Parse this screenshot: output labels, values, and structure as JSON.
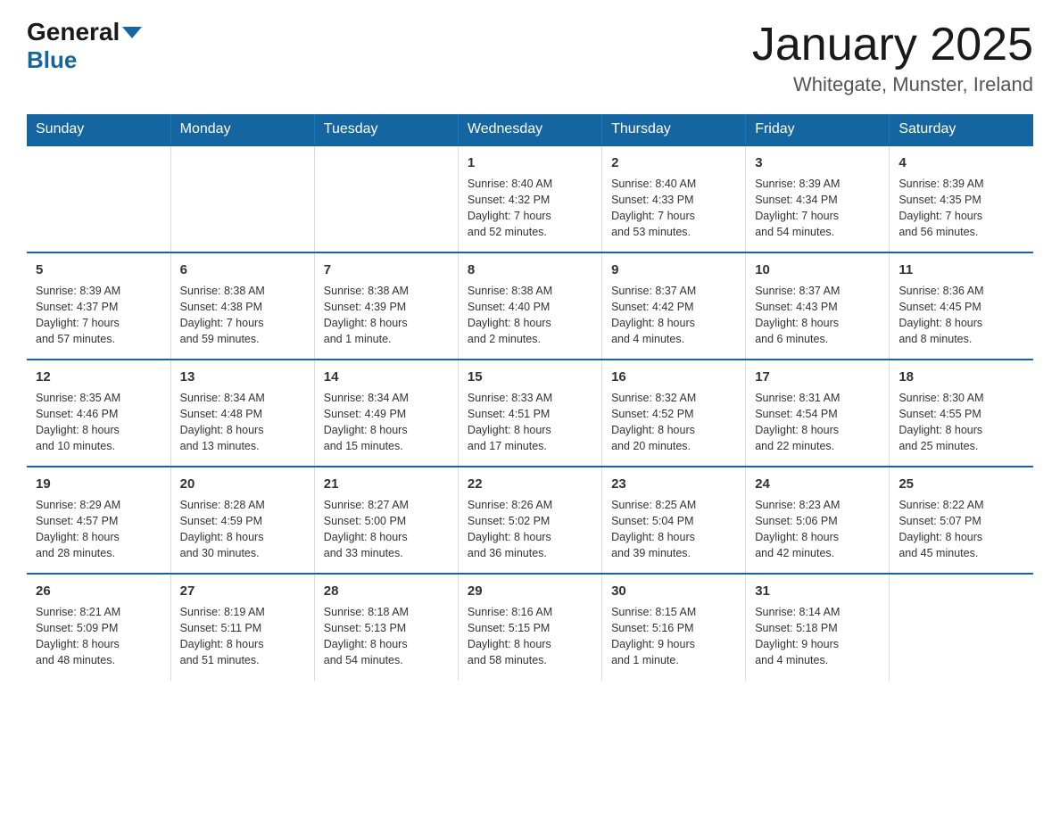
{
  "header": {
    "logo_general": "General",
    "logo_blue": "Blue",
    "month_title": "January 2025",
    "location": "Whitegate, Munster, Ireland"
  },
  "days_of_week": [
    "Sunday",
    "Monday",
    "Tuesday",
    "Wednesday",
    "Thursday",
    "Friday",
    "Saturday"
  ],
  "weeks": [
    [
      {
        "day": "",
        "info": ""
      },
      {
        "day": "",
        "info": ""
      },
      {
        "day": "",
        "info": ""
      },
      {
        "day": "1",
        "info": "Sunrise: 8:40 AM\nSunset: 4:32 PM\nDaylight: 7 hours\nand 52 minutes."
      },
      {
        "day": "2",
        "info": "Sunrise: 8:40 AM\nSunset: 4:33 PM\nDaylight: 7 hours\nand 53 minutes."
      },
      {
        "day": "3",
        "info": "Sunrise: 8:39 AM\nSunset: 4:34 PM\nDaylight: 7 hours\nand 54 minutes."
      },
      {
        "day": "4",
        "info": "Sunrise: 8:39 AM\nSunset: 4:35 PM\nDaylight: 7 hours\nand 56 minutes."
      }
    ],
    [
      {
        "day": "5",
        "info": "Sunrise: 8:39 AM\nSunset: 4:37 PM\nDaylight: 7 hours\nand 57 minutes."
      },
      {
        "day": "6",
        "info": "Sunrise: 8:38 AM\nSunset: 4:38 PM\nDaylight: 7 hours\nand 59 minutes."
      },
      {
        "day": "7",
        "info": "Sunrise: 8:38 AM\nSunset: 4:39 PM\nDaylight: 8 hours\nand 1 minute."
      },
      {
        "day": "8",
        "info": "Sunrise: 8:38 AM\nSunset: 4:40 PM\nDaylight: 8 hours\nand 2 minutes."
      },
      {
        "day": "9",
        "info": "Sunrise: 8:37 AM\nSunset: 4:42 PM\nDaylight: 8 hours\nand 4 minutes."
      },
      {
        "day": "10",
        "info": "Sunrise: 8:37 AM\nSunset: 4:43 PM\nDaylight: 8 hours\nand 6 minutes."
      },
      {
        "day": "11",
        "info": "Sunrise: 8:36 AM\nSunset: 4:45 PM\nDaylight: 8 hours\nand 8 minutes."
      }
    ],
    [
      {
        "day": "12",
        "info": "Sunrise: 8:35 AM\nSunset: 4:46 PM\nDaylight: 8 hours\nand 10 minutes."
      },
      {
        "day": "13",
        "info": "Sunrise: 8:34 AM\nSunset: 4:48 PM\nDaylight: 8 hours\nand 13 minutes."
      },
      {
        "day": "14",
        "info": "Sunrise: 8:34 AM\nSunset: 4:49 PM\nDaylight: 8 hours\nand 15 minutes."
      },
      {
        "day": "15",
        "info": "Sunrise: 8:33 AM\nSunset: 4:51 PM\nDaylight: 8 hours\nand 17 minutes."
      },
      {
        "day": "16",
        "info": "Sunrise: 8:32 AM\nSunset: 4:52 PM\nDaylight: 8 hours\nand 20 minutes."
      },
      {
        "day": "17",
        "info": "Sunrise: 8:31 AM\nSunset: 4:54 PM\nDaylight: 8 hours\nand 22 minutes."
      },
      {
        "day": "18",
        "info": "Sunrise: 8:30 AM\nSunset: 4:55 PM\nDaylight: 8 hours\nand 25 minutes."
      }
    ],
    [
      {
        "day": "19",
        "info": "Sunrise: 8:29 AM\nSunset: 4:57 PM\nDaylight: 8 hours\nand 28 minutes."
      },
      {
        "day": "20",
        "info": "Sunrise: 8:28 AM\nSunset: 4:59 PM\nDaylight: 8 hours\nand 30 minutes."
      },
      {
        "day": "21",
        "info": "Sunrise: 8:27 AM\nSunset: 5:00 PM\nDaylight: 8 hours\nand 33 minutes."
      },
      {
        "day": "22",
        "info": "Sunrise: 8:26 AM\nSunset: 5:02 PM\nDaylight: 8 hours\nand 36 minutes."
      },
      {
        "day": "23",
        "info": "Sunrise: 8:25 AM\nSunset: 5:04 PM\nDaylight: 8 hours\nand 39 minutes."
      },
      {
        "day": "24",
        "info": "Sunrise: 8:23 AM\nSunset: 5:06 PM\nDaylight: 8 hours\nand 42 minutes."
      },
      {
        "day": "25",
        "info": "Sunrise: 8:22 AM\nSunset: 5:07 PM\nDaylight: 8 hours\nand 45 minutes."
      }
    ],
    [
      {
        "day": "26",
        "info": "Sunrise: 8:21 AM\nSunset: 5:09 PM\nDaylight: 8 hours\nand 48 minutes."
      },
      {
        "day": "27",
        "info": "Sunrise: 8:19 AM\nSunset: 5:11 PM\nDaylight: 8 hours\nand 51 minutes."
      },
      {
        "day": "28",
        "info": "Sunrise: 8:18 AM\nSunset: 5:13 PM\nDaylight: 8 hours\nand 54 minutes."
      },
      {
        "day": "29",
        "info": "Sunrise: 8:16 AM\nSunset: 5:15 PM\nDaylight: 8 hours\nand 58 minutes."
      },
      {
        "day": "30",
        "info": "Sunrise: 8:15 AM\nSunset: 5:16 PM\nDaylight: 9 hours\nand 1 minute."
      },
      {
        "day": "31",
        "info": "Sunrise: 8:14 AM\nSunset: 5:18 PM\nDaylight: 9 hours\nand 4 minutes."
      },
      {
        "day": "",
        "info": ""
      }
    ]
  ]
}
